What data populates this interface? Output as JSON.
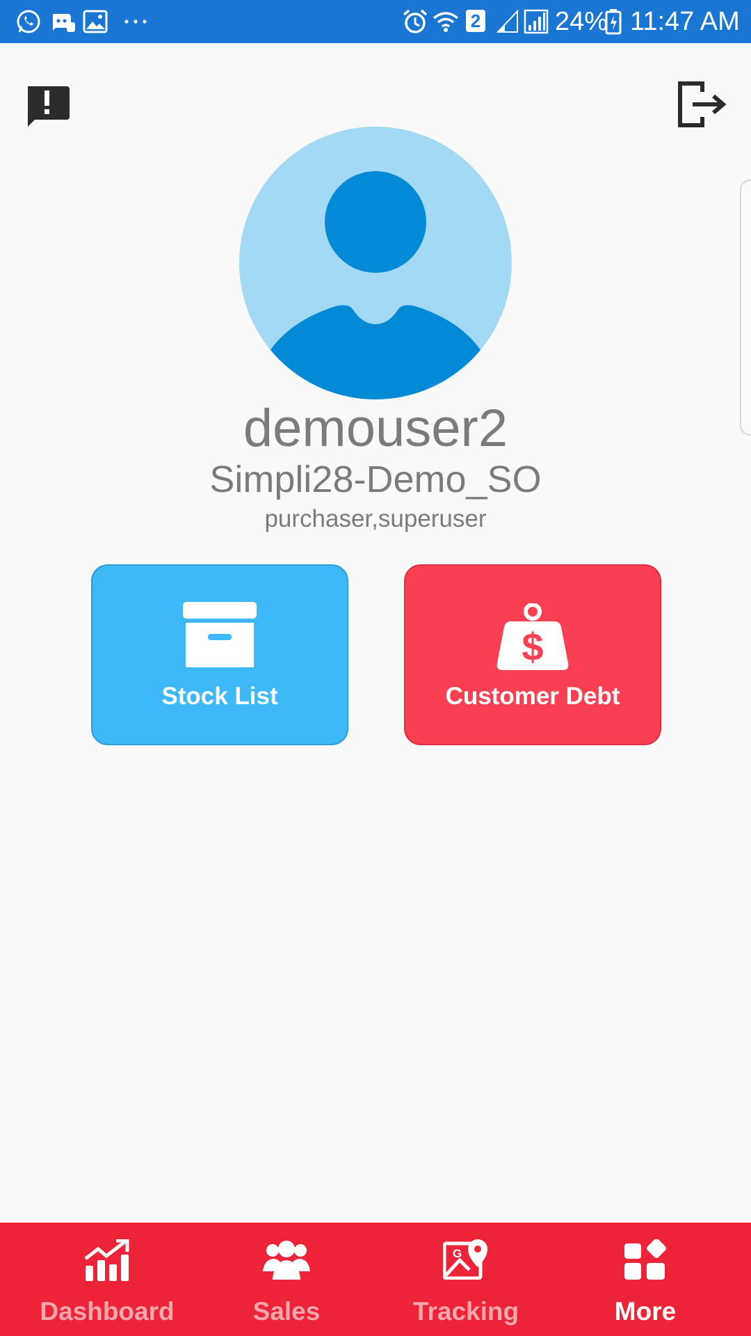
{
  "status_bar": {
    "left_icons": [
      "whatsapp-icon",
      "discord-icon",
      "gallery-icon",
      "more-dots-icon"
    ],
    "right_icons": [
      "alarm-icon",
      "wifi-icon",
      "sim2-icon",
      "signal-icon",
      "battery-icon"
    ],
    "sim_label": "2",
    "battery_percent": "24%",
    "time": "11:47 AM"
  },
  "top_actions": {
    "feedback_icon": "feedback-icon",
    "logout_icon": "logout-icon"
  },
  "profile": {
    "username": "demouser2",
    "company": "Simpli28-Demo_SO",
    "roles": "purchaser,superuser"
  },
  "tiles": [
    {
      "label": "Stock List",
      "icon": "archive-box-icon",
      "color": "#3db9f7"
    },
    {
      "label": "Customer Debt",
      "icon": "money-bag-icon",
      "color": "#fb3f52"
    }
  ],
  "bottom_nav": {
    "background": "#ed2338",
    "items": [
      {
        "label": "Dashboard",
        "icon": "chart-up-icon",
        "active": false
      },
      {
        "label": "Sales",
        "icon": "people-icon",
        "active": false
      },
      {
        "label": "Tracking",
        "icon": "map-pin-icon",
        "active": false
      },
      {
        "label": "More",
        "icon": "apps-grid-icon",
        "active": true
      }
    ]
  }
}
